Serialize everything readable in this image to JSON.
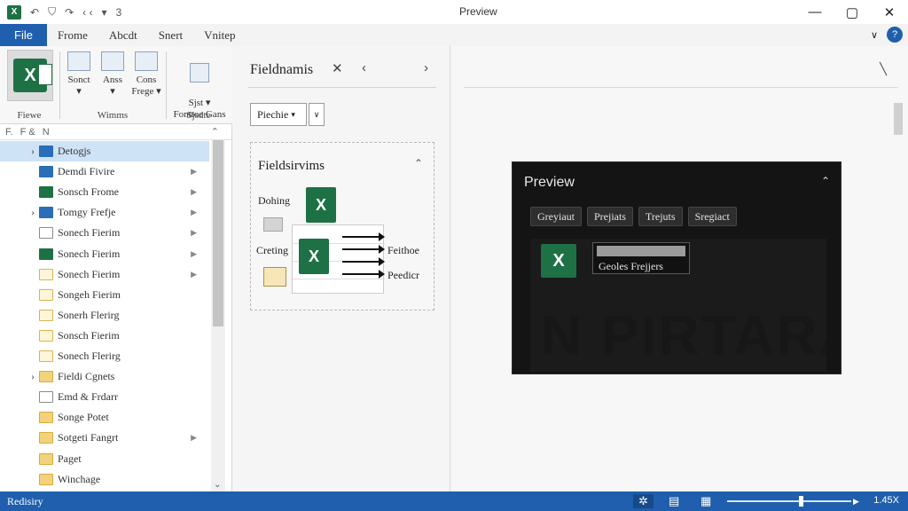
{
  "titlebar": {
    "title": "Preview",
    "qat_extra": "3",
    "controls": {
      "minimize": "—",
      "maximize": "▢",
      "close": "✕"
    }
  },
  "menubar": {
    "tabs": [
      "File",
      "Frome",
      "Abcdt",
      "Snert",
      "Vnitep"
    ]
  },
  "ribbon": {
    "group1": {
      "label": "Fiewe"
    },
    "group2": {
      "label": "Wimms",
      "buttons": [
        "Sonct",
        "Anss",
        "Cons Frege"
      ]
    },
    "group3": {
      "label": "Sjsdte",
      "button": "Sjst ▾\nFonttoe Gans"
    }
  },
  "tree": {
    "header": [
      "F.",
      "F &",
      "N"
    ],
    "items": [
      {
        "label": "Detogjs",
        "icon": "folder-blue",
        "expandable": true,
        "selected": true,
        "arrow": false
      },
      {
        "label": "Demdi Fivire",
        "icon": "folder-blue",
        "expandable": false,
        "selected": false,
        "arrow": true
      },
      {
        "label": "Sonsch Frome",
        "icon": "sheet-green",
        "expandable": false,
        "selected": false,
        "arrow": true
      },
      {
        "label": "Tomgy Frefje",
        "icon": "folder-blue",
        "expandable": true,
        "selected": false,
        "arrow": true
      },
      {
        "label": "Sonech Fierim",
        "icon": "doc",
        "expandable": false,
        "selected": false,
        "arrow": true
      },
      {
        "label": "Sonech Fierim",
        "icon": "sheet-green",
        "expandable": false,
        "selected": false,
        "arrow": true
      },
      {
        "label": "Sonech Fierim",
        "icon": "folder-outline",
        "expandable": false,
        "selected": false,
        "arrow": true
      },
      {
        "label": "Songeh Fierim",
        "icon": "folder-outline",
        "expandable": false,
        "selected": false,
        "arrow": false
      },
      {
        "label": "Sonerh Flerirg",
        "icon": "folder-outline",
        "expandable": false,
        "selected": false,
        "arrow": false
      },
      {
        "label": "Sonsch Fierim",
        "icon": "folder-outline",
        "expandable": false,
        "selected": false,
        "arrow": false
      },
      {
        "label": "Sonech Flerirg",
        "icon": "folder-outline",
        "expandable": false,
        "selected": false,
        "arrow": false
      },
      {
        "label": "Fieldi Cgnets",
        "icon": "folder-yellow",
        "expandable": true,
        "selected": false,
        "arrow": false
      },
      {
        "label": "Emd & Frdarr",
        "icon": "doc",
        "expandable": false,
        "selected": false,
        "arrow": false
      },
      {
        "label": "Songe Potet",
        "icon": "folder-yellow",
        "expandable": false,
        "selected": false,
        "arrow": false
      },
      {
        "label": "Sotgeti Fangrt",
        "icon": "folder-yellow",
        "expandable": false,
        "selected": false,
        "arrow": true
      },
      {
        "label": "Paget",
        "icon": "folder-yellow",
        "expandable": false,
        "selected": false,
        "arrow": false
      },
      {
        "label": "Winchage",
        "icon": "folder-yellow",
        "expandable": false,
        "selected": false,
        "arrow": false
      }
    ]
  },
  "fieldpane": {
    "title": "Fieldnamis",
    "combo_value": "Piechie",
    "section_title": "Fieldsirvims",
    "labels": {
      "top_left": "Dohing",
      "mid_left": "Creting",
      "right_top": "Feithoe",
      "right_bottom": "Peedicr"
    }
  },
  "preview": {
    "title": "Preview",
    "tabs": [
      "Greyiaut",
      "Prejiats",
      "Trejuts",
      "Sregiact"
    ],
    "file_name": "Geoles Frejjers",
    "watermark": "N PIRTARABO"
  },
  "statusbar": {
    "text": "Redisiry",
    "zoom": "1.45X",
    "zoom_fraction": 0.58
  }
}
